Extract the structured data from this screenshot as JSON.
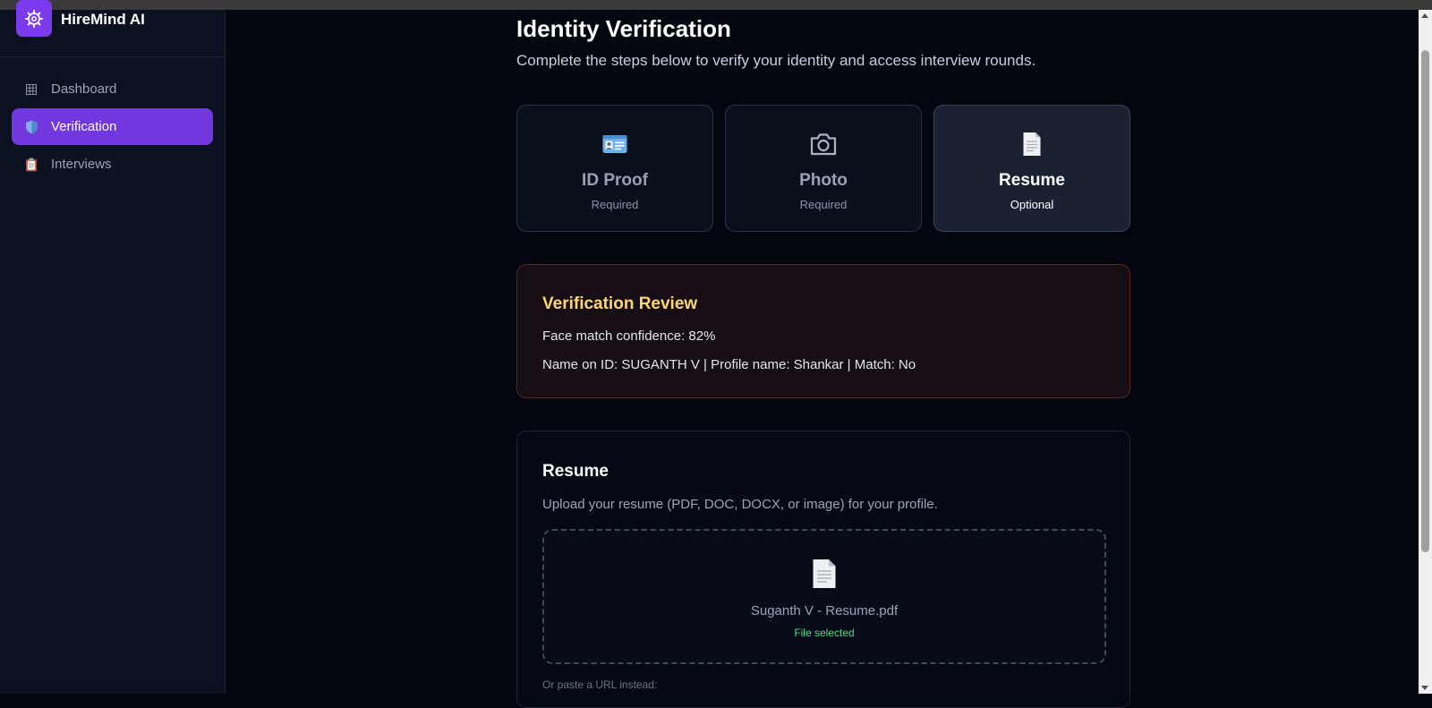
{
  "app": {
    "name": "HireMind AI"
  },
  "sidebar": {
    "items": [
      {
        "label": "Dashboard",
        "icon": "grid-icon",
        "active": false
      },
      {
        "label": "Verification",
        "icon": "shield-icon",
        "active": true
      },
      {
        "label": "Interviews",
        "icon": "clipboard-icon",
        "active": false
      }
    ]
  },
  "page": {
    "title": "Identity Verification",
    "subtitle": "Complete the steps below to verify your identity and access interview rounds."
  },
  "steps": [
    {
      "title": "ID Proof",
      "status": "Required",
      "icon": "id-card-icon",
      "current": false
    },
    {
      "title": "Photo",
      "status": "Required",
      "icon": "camera-icon",
      "current": false
    },
    {
      "title": "Resume",
      "status": "Optional",
      "icon": "document-icon",
      "current": true
    }
  ],
  "review": {
    "title": "Verification Review",
    "face_match": "Face match confidence: 82%",
    "name_match": "Name on ID: SUGANTH V | Profile name: Shankar | Match: No"
  },
  "resume": {
    "title": "Resume",
    "description": "Upload your resume (PDF, DOC, DOCX, or image) for your profile.",
    "file_name": "Suganth V - Resume.pdf",
    "file_status": "File selected",
    "url_label": "Or paste a URL instead:"
  },
  "colors": {
    "accent": "#7237dd",
    "background": "#04060f",
    "review_title": "#fcd675",
    "success": "#4ade80"
  }
}
